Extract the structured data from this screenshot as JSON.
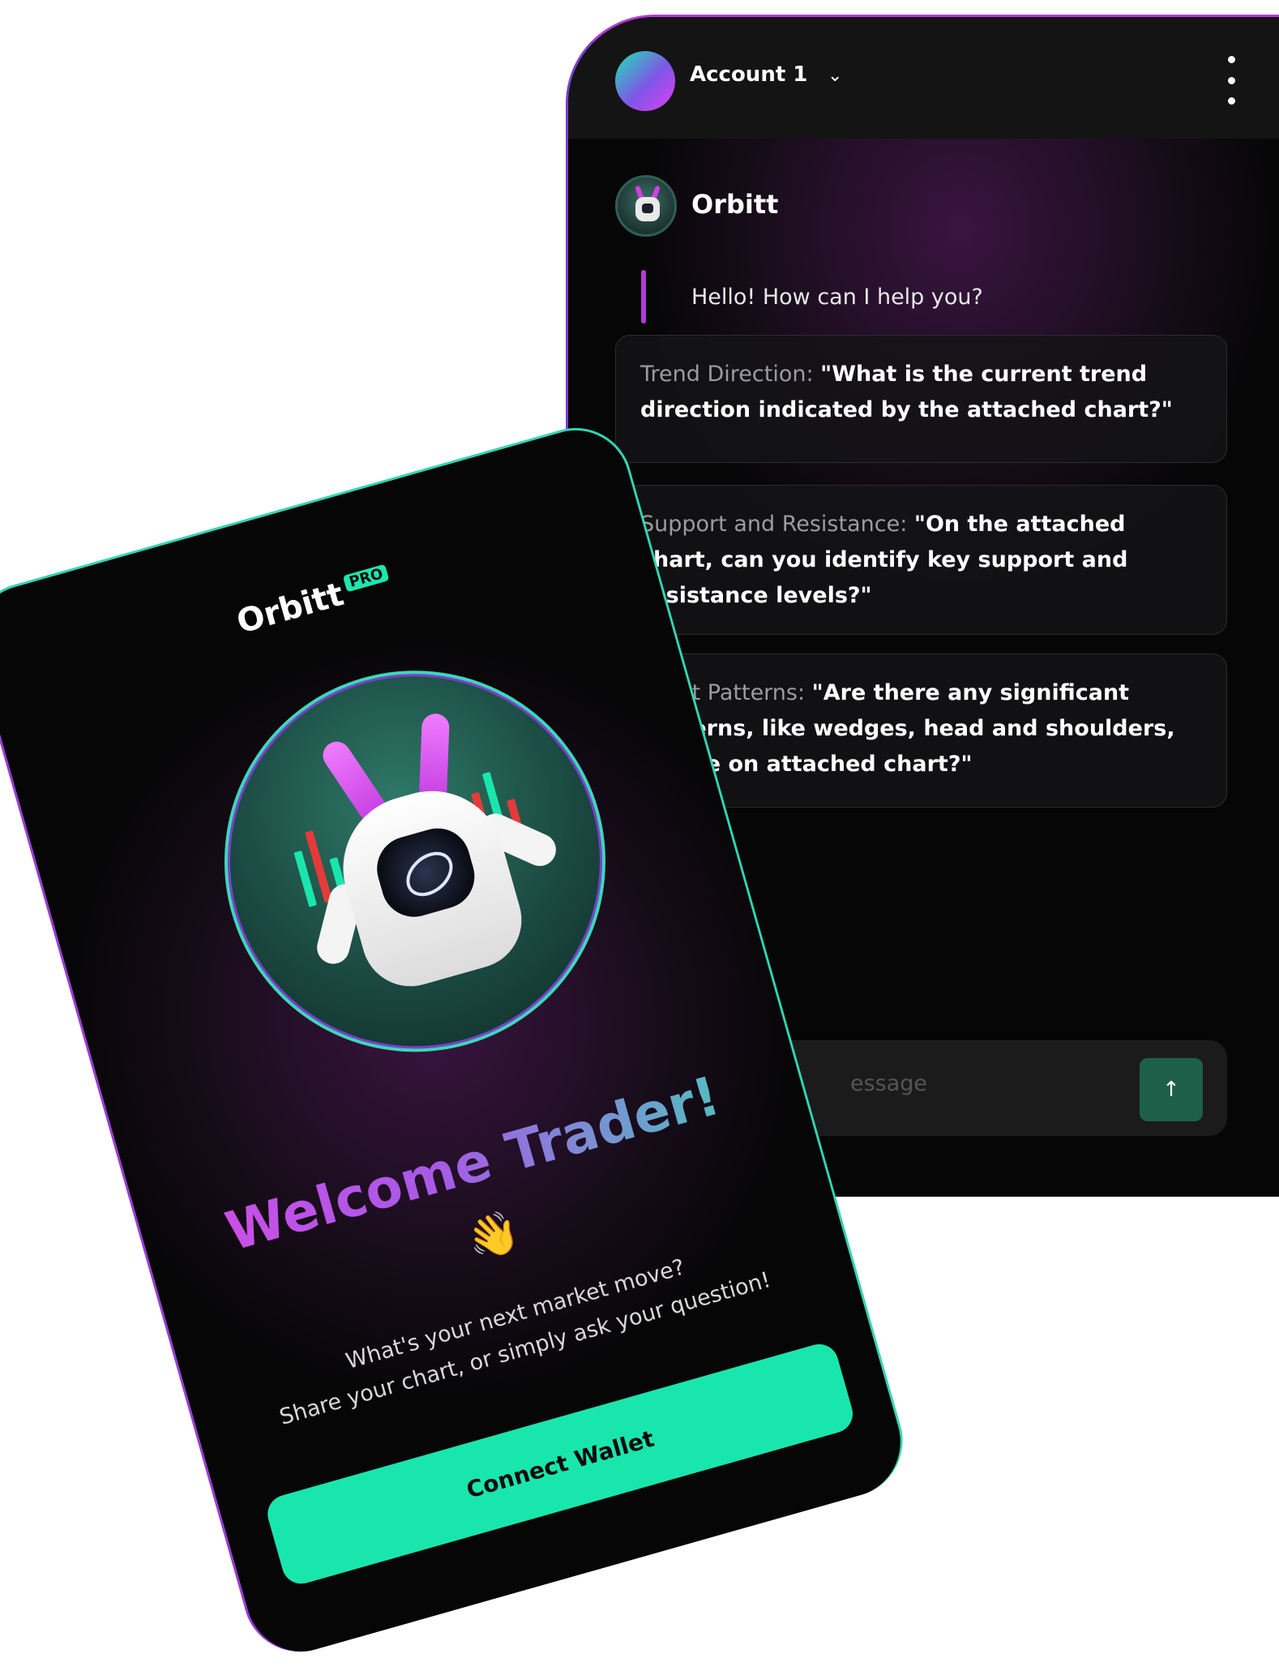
{
  "chat": {
    "account_label": "Account 1",
    "bot_name": "Orbitt",
    "greeting": "Hello! How can I help you?",
    "prompts": [
      {
        "keyword": "Trend Direction: ",
        "question": "\"What is the current trend direction indicated by the attached chart?\""
      },
      {
        "keyword": "Support and Resistance: ",
        "question": "\"On the attached chart, can you identify key support and resistance levels?\""
      },
      {
        "keyword": "Chart Patterns: ",
        "question": "\"Are there any significant patterns, like wedges, head and shoulders, visible on attached chart?\""
      }
    ],
    "input_placeholder": "essage",
    "send_icon": "↑"
  },
  "welcome": {
    "brand": "Orbitt",
    "badge": "PRO",
    "title": "Welcome Trader!",
    "wave_emoji": "👋",
    "subtitle_line1": "What's your next market move?",
    "subtitle_line2": "Share your chart, or simply ask your question!",
    "button_label": "Connect Wallet"
  },
  "colors": {
    "accent_green": "#19e6ad",
    "accent_purple": "#b43ad8",
    "background": "#060606"
  }
}
